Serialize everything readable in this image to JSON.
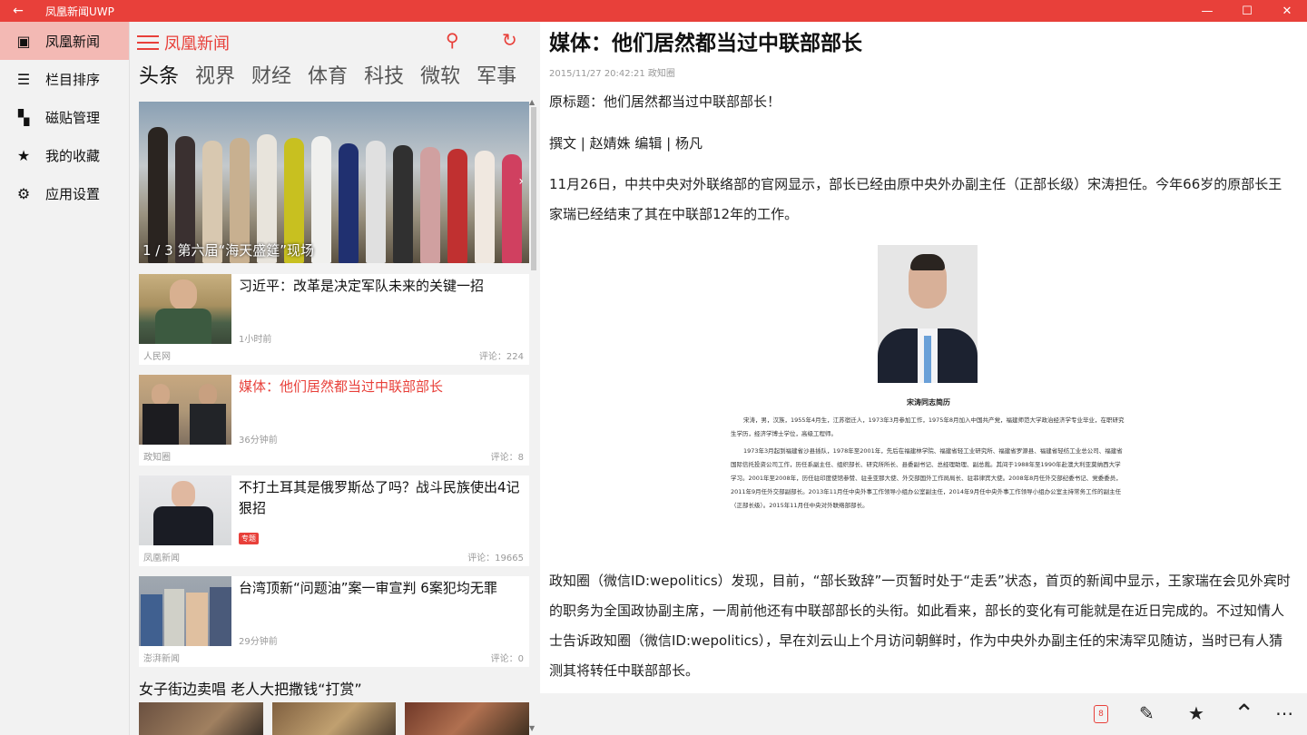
{
  "window": {
    "title": "凤凰新闻UWP",
    "back": "←",
    "minimize": "—",
    "maximize": "☐",
    "close": "✕"
  },
  "nav": {
    "items": [
      {
        "label": "凤凰新闻",
        "icon": "news-icon",
        "glyph": "▣"
      },
      {
        "label": "栏目排序",
        "icon": "sort-icon",
        "glyph": "☰"
      },
      {
        "label": "磁贴管理",
        "icon": "tiles-icon",
        "glyph": "▚"
      },
      {
        "label": "我的收藏",
        "icon": "star-icon",
        "glyph": "★"
      },
      {
        "label": "应用设置",
        "icon": "gear-icon",
        "glyph": "⚙"
      }
    ]
  },
  "list": {
    "header_title": "凤凰新闻",
    "search_icon": "⚲",
    "refresh_icon": "↻",
    "tabs": [
      "头条",
      "视界",
      "财经",
      "体育",
      "科技",
      "微软",
      "军事"
    ],
    "hero_caption": "1 / 3 第六届“海天盛筵”现场",
    "hero_next": "›",
    "scroll_up": "▲",
    "scroll_down": "▼",
    "items": [
      {
        "title": "习近平：改革是决定军队未来的关键一招",
        "time": "1小时前",
        "source": "人民网",
        "comments": "评论：224"
      },
      {
        "title": "媒体：他们居然都当过中联部部长",
        "time": "36分钟前",
        "source": "政知圈",
        "comments": "评论：8"
      },
      {
        "title": "不打土耳其是俄罗斯怂了吗？战斗民族使出4记狠招",
        "badge": "专题",
        "source": "凤凰新闻",
        "comments": "评论：19665"
      },
      {
        "title": "台湾顶新“问题油”案一审宣判 6案犯均无罪",
        "time": "29分钟前",
        "source": "澎湃新闻",
        "comments": "评论：0"
      }
    ],
    "photo_title": "女子街边卖唱 老人大把撒钱“打赏”"
  },
  "article": {
    "title": "媒体：他们居然都当过中联部部长",
    "meta": "2015/11/27 20:42:21 政知圈",
    "p1": "原标题：他们居然都当过中联部部长！",
    "p2": "撰文 | 赵婧姝 编辑 | 杨凡",
    "p3": "11月26日，中共中央对外联络部的官网显示，部长已经由原中央外办副主任（正部长级）宋涛担任。今年66岁的原部长王家瑞已经结束了其在中联部12年的工作。",
    "figure_caption": "宋涛同志简历",
    "figure_text1": "宋涛，男，汉族，1955年4月生，江苏宿迁人，1973年3月参加工作，1975年8月加入中国共产党，福建师范大学政治经济学专业毕业，在职研究生学历，经济学博士学位，高级工程师。",
    "figure_text2": "1973年3月起到福建省沙县插队，1978年至2001年，先后在福建林学院、福建省轻工业研究所、福建省罗源县、福建省轻纺工业总公司、福建省国际信托投资公司工作，历任系副主任、组织部长、研究所所长、县委副书记、总经理助理、副总裁。其间于1988年至1990年赴澳大利亚莫纳西大学学习。2001年至2008年，历任驻印度使馆参赞、驻圭亚那大使、外交部国外工作局局长、驻菲律宾大使。2008年8月任外交部纪委书记、党委委员，2011年9月任外交部副部长。2013年11月任中央外事工作领导小组办公室副主任，2014年9月任中央外事工作领导小组办公室主持常务工作的副主任（正部长级）。2015年11月任中央对外联络部部长。",
    "p4": "政知圈（微信ID:wepolitics）发现，目前，“部长致辞”一页暂时处于“走丢”状态，首页的新闻中显示，王家瑞在会见外宾时的职务为全国政协副主席，一周前他还有中联部部长的头衔。如此看来，部长的变化有可能就是在近日完成的。不过知情人士告诉政知圈（微信ID:wepolitics），早在刘云山上个月访问朝鲜时，作为中央外办副主任的宋涛罕见随访，当时已有人猜测其将转任中联部部长。"
  },
  "bottombar": {
    "comment_count": "8",
    "share_icon": "✎",
    "favorite_icon": "★",
    "top_icon": "⌃",
    "more_icon": "⋯"
  },
  "colors": {
    "accent": "#e8403a",
    "nav_active": "#f3b9b4"
  }
}
